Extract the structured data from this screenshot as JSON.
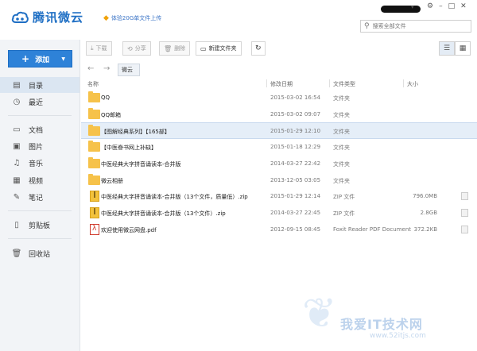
{
  "app": {
    "logo_text": "腾讯微云",
    "promo_text": "体验20G单文件上传",
    "window_controls": [
      "⚙",
      "–",
      "□",
      "✕"
    ]
  },
  "search": {
    "placeholder": "搜索全部文件"
  },
  "sidebar": {
    "add_label": "添加",
    "items": [
      {
        "label": "目录",
        "icon": "directory-icon"
      },
      {
        "label": "最近",
        "icon": "clock-icon"
      },
      {
        "label": "文档",
        "icon": "document-icon"
      },
      {
        "label": "图片",
        "icon": "image-icon"
      },
      {
        "label": "音乐",
        "icon": "music-icon"
      },
      {
        "label": "视频",
        "icon": "video-icon"
      },
      {
        "label": "笔记",
        "icon": "note-icon"
      },
      {
        "label": "剪贴板",
        "icon": "clipboard-icon"
      },
      {
        "label": "回收站",
        "icon": "trash-icon"
      }
    ]
  },
  "toolbar": {
    "download": "下载",
    "share": "分享",
    "delete": "删除",
    "new_folder": "新建文件夹"
  },
  "breadcrumb": {
    "current": "微云"
  },
  "columns": {
    "name": "名称",
    "date": "修改日期",
    "type": "文件类型",
    "size": "大小"
  },
  "files": [
    {
      "name": "QQ",
      "date": "2015-03-02 16:54",
      "type": "文件夹",
      "size": "",
      "kind": "folder"
    },
    {
      "name": "QQ邮箱",
      "date": "2015-03-02 09:07",
      "type": "文件夹",
      "size": "",
      "kind": "folder"
    },
    {
      "name": "【图解经典系列】【165部】",
      "date": "2015-01-29 12:10",
      "type": "文件夹",
      "size": "",
      "kind": "folder"
    },
    {
      "name": "【中医眷书网上补缺】",
      "date": "2015-01-18 12:29",
      "type": "文件夹",
      "size": "",
      "kind": "folder"
    },
    {
      "name": "中医经典大字拼音诵读本-合并版",
      "date": "2014-03-27 22:42",
      "type": "文件夹",
      "size": "",
      "kind": "folder"
    },
    {
      "name": "微云相册",
      "date": "2013-12-05 03:05",
      "type": "文件夹",
      "size": "",
      "kind": "folder"
    },
    {
      "name": "中医经典大字拼音诵读本-合并版（13个文件，质量低）.zip",
      "date": "2015-01-29 12:14",
      "type": "ZIP 文件",
      "size": "796.0MB",
      "kind": "zip"
    },
    {
      "name": "中医经典大字拼音诵读本-合并版（13个文件）.zip",
      "date": "2014-03-27 22:45",
      "type": "ZIP 文件",
      "size": "2.8GB",
      "kind": "zip"
    },
    {
      "name": "欢迎使用微云网盘.pdf",
      "date": "2012-09-15 08:45",
      "type": "Foxit Reader PDF Document",
      "size": "372.2KB",
      "kind": "pdf"
    }
  ],
  "watermark": {
    "text": "我爱IT技术网",
    "url": "www.52itjs.com"
  }
}
